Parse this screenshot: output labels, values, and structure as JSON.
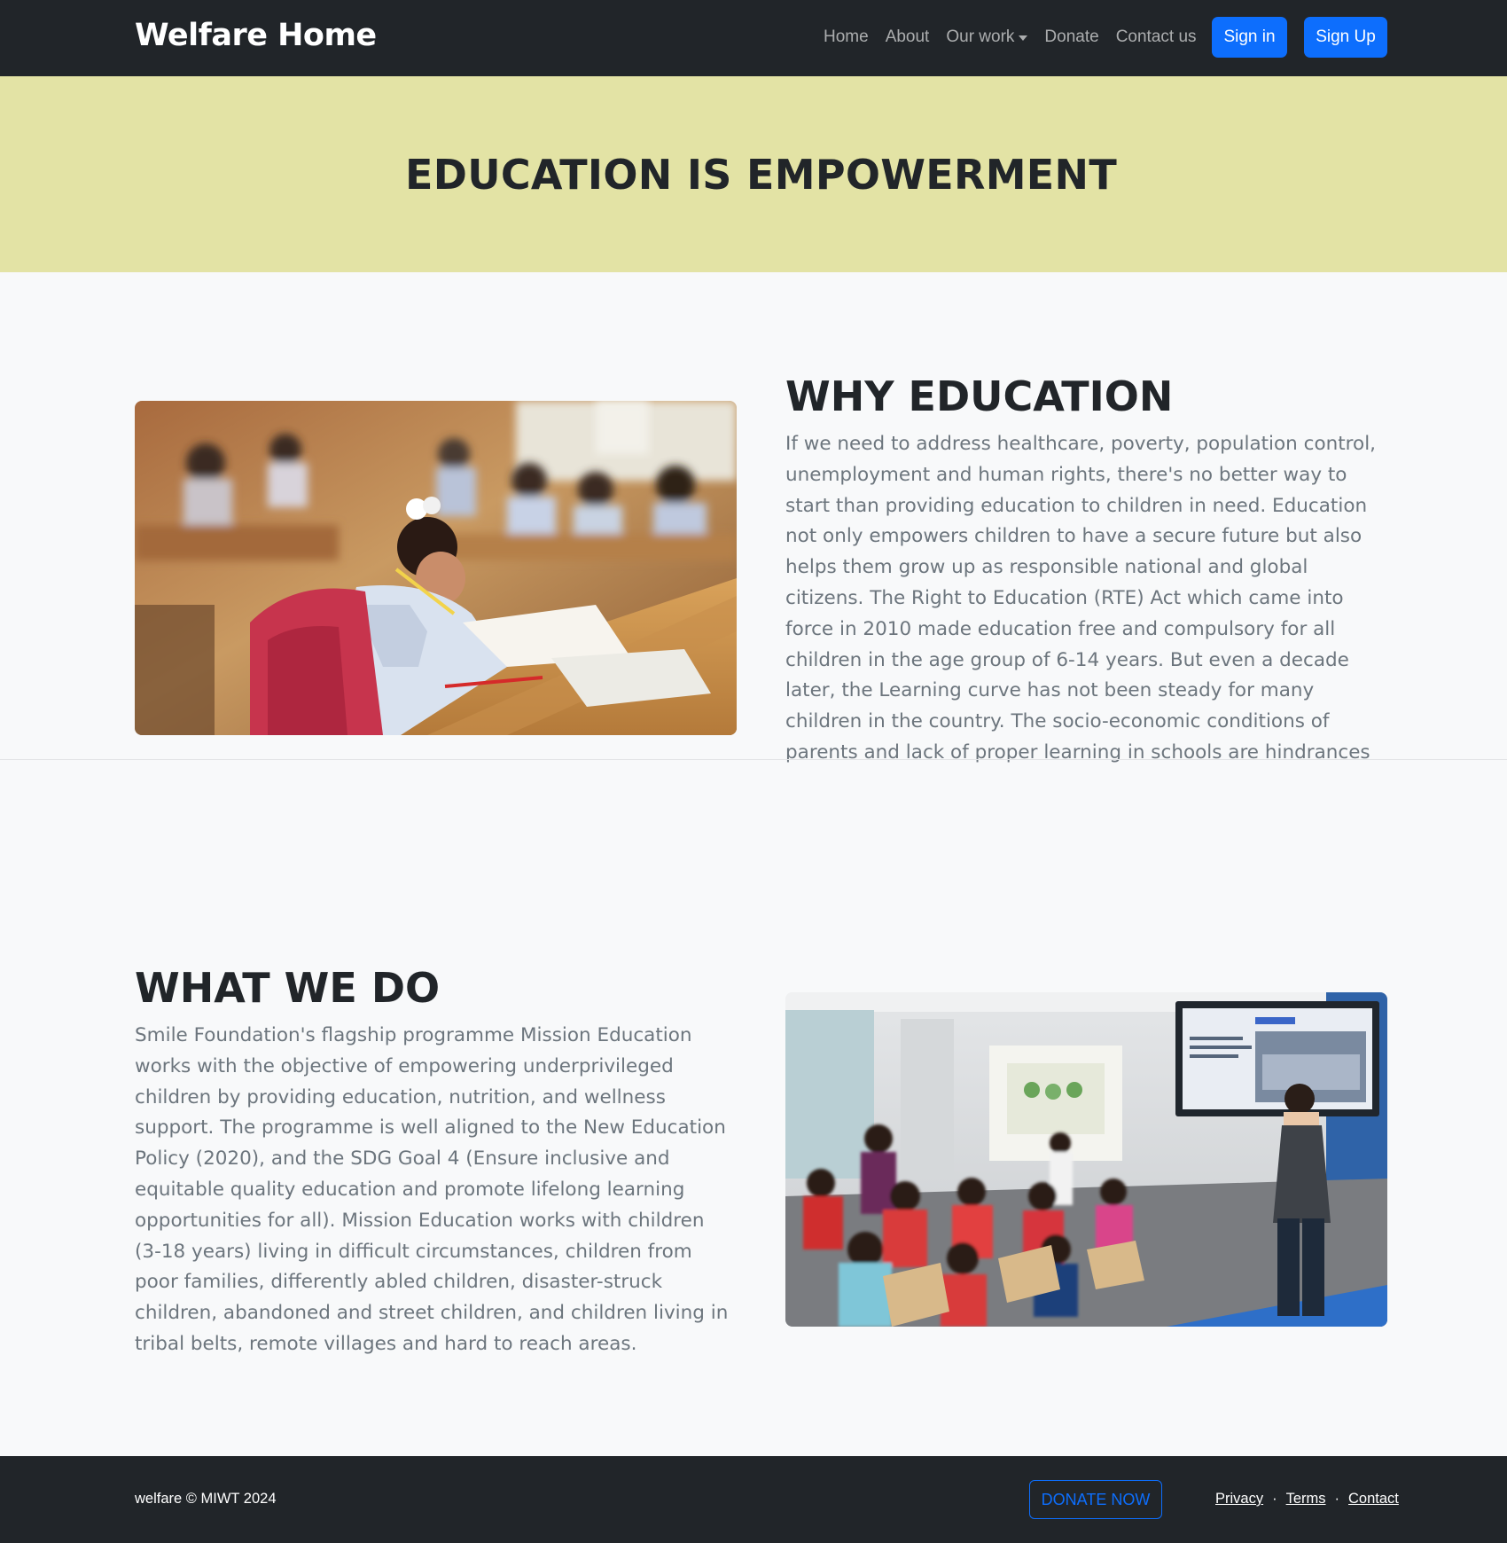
{
  "navbar": {
    "brand": "Welfare Home",
    "links": [
      "Home",
      "About",
      "Our work",
      "Donate",
      "Contact us"
    ],
    "signin_label": "Sign in",
    "signup_label": "Sign Up"
  },
  "hero": {
    "title": "EDUCATION IS EMPOWERMENT"
  },
  "why": {
    "heading": "WHY EDUCATION",
    "text": "If we need to address healthcare, poverty, population control, unemployment and human rights, there's no better way to start than providing education to children in need. Education not only empowers children to have a secure future but also helps them grow up as responsible national and global citizens. The Right to Education (RTE) Act which came into force in 2010 made education free and compulsory for all children in the age group of 6-14 years. But even a decade later, the Learning curve has not been steady for many children in the country. The socio-economic conditions of parents and lack of proper learning in schools are hindrances which prevent many children from having education"
  },
  "what": {
    "heading": "WHAT WE DO",
    "text": "Smile Foundation's flagship programme Mission Education works with the objective of empowering underprivileged children by providing education, nutrition, and wellness support. The programme is well aligned to the New Education Policy (2020), and the SDG Goal 4 (Ensure inclusive and equitable quality education and promote lifelong learning opportunities for all). Mission Education works with children (3-18 years) living in difficult circumstances, children from poor families, differently abled children, disaster-struck children, abandoned and street children, and children living in tribal belts, remote villages and hard to reach areas."
  },
  "footer": {
    "copyright": "welfare © MIWT 2024",
    "donate_label": "DONATE NOW",
    "links": [
      "Privacy",
      "Terms",
      "Contact"
    ],
    "separator": "·"
  },
  "colors": {
    "navbar_bg": "#212529",
    "hero_bg": "#e3e3a5",
    "primary": "#0d6efd",
    "body_bg": "#f8f9fa",
    "muted_text": "#6c757d"
  },
  "icons": {
    "dropdown": "caret-down-icon"
  }
}
